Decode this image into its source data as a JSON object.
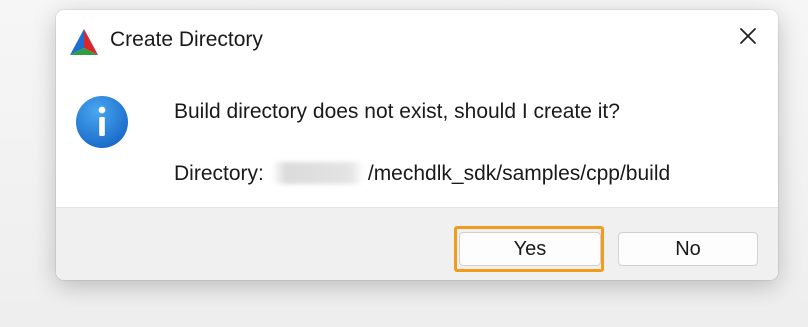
{
  "dialog": {
    "title": "Create Directory",
    "app_icon": "cmake-triangle-icon",
    "close_icon": "close-icon",
    "info_icon": "info-icon",
    "message": "Build directory does not exist, should I create it?",
    "directory_label": "Directory:",
    "directory_path_visible": "/mechdlk_sdk/samples/cpp/build",
    "buttons": {
      "yes": "Yes",
      "no": "No"
    },
    "colors": {
      "focus_outline": "#f29b1d",
      "info_blue": "#1e7fd8"
    }
  }
}
